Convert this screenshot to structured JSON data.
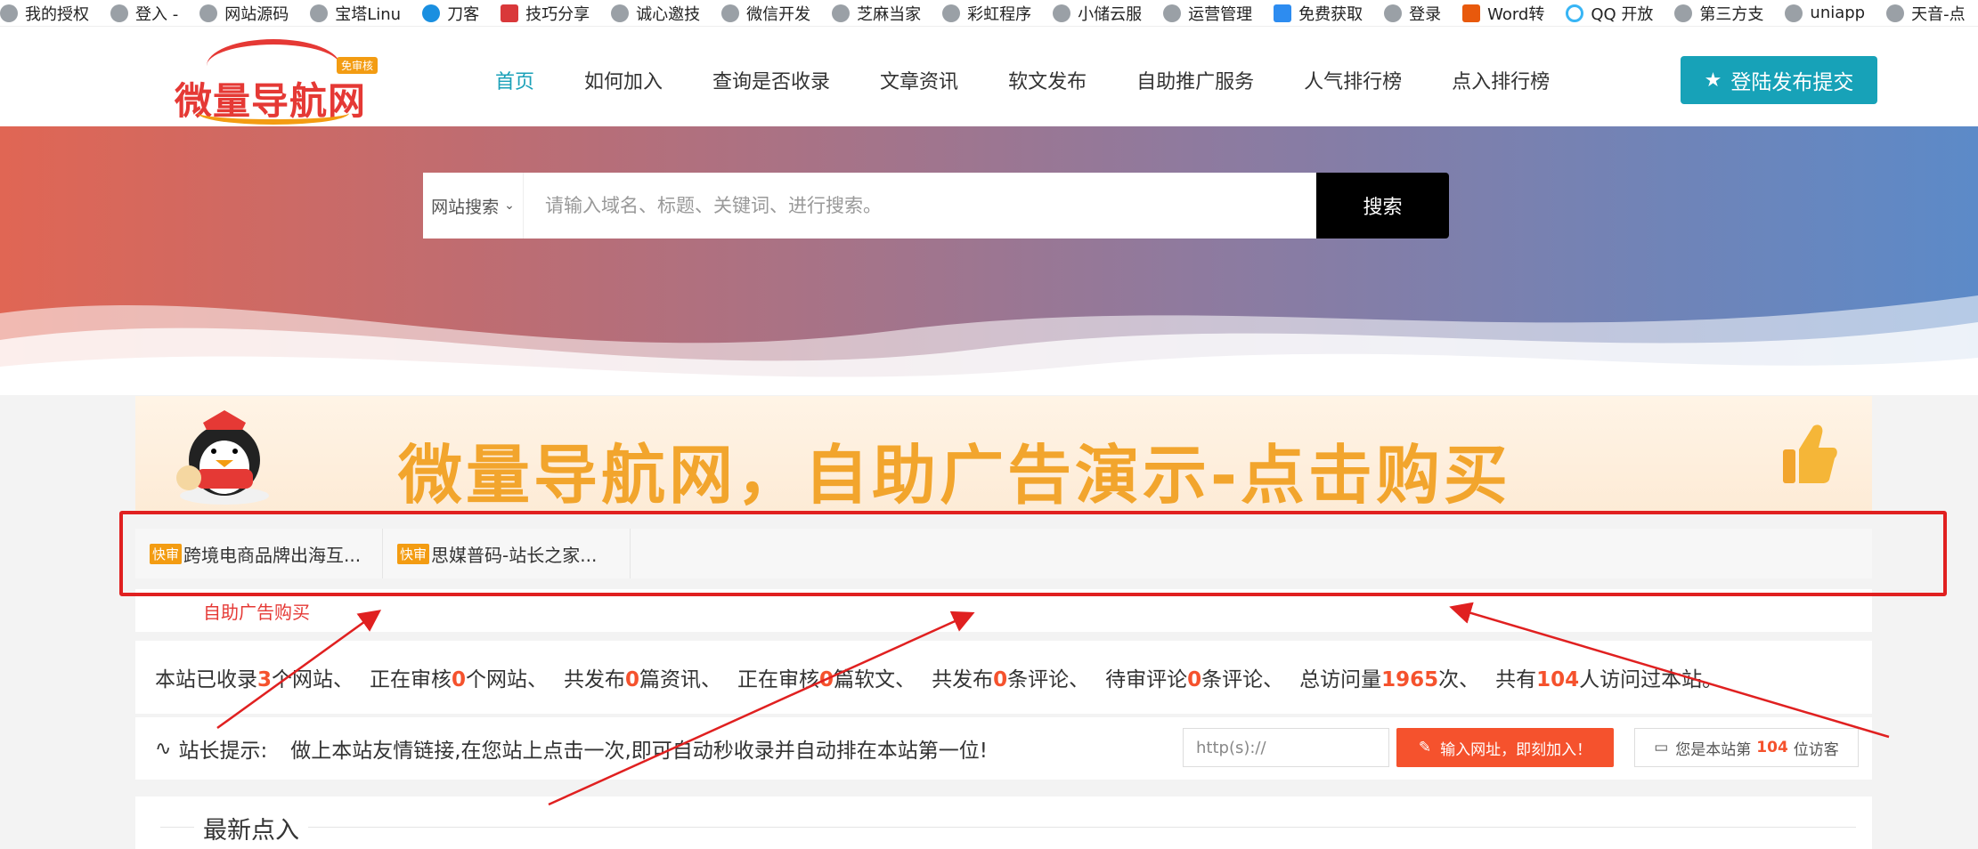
{
  "bookmarks": [
    {
      "label": "我的授权",
      "icon": "globe-icon"
    },
    {
      "label": "登入 -",
      "icon": "globe-icon"
    },
    {
      "label": "网站源码",
      "icon": "globe-icon"
    },
    {
      "label": "宝塔Linu",
      "icon": "globe-icon"
    },
    {
      "label": "刀客",
      "icon": "download-icon"
    },
    {
      "label": "技巧分享",
      "icon": "news-icon"
    },
    {
      "label": "诚心邀技",
      "icon": "globe-icon"
    },
    {
      "label": "微信开发",
      "icon": "globe-icon"
    },
    {
      "label": "芝麻当家",
      "icon": "globe-icon"
    },
    {
      "label": "彩虹程序",
      "icon": "globe-icon"
    },
    {
      "label": "小储云服",
      "icon": "globe-icon"
    },
    {
      "label": "运营管理",
      "icon": "globe-icon"
    },
    {
      "label": "免费获取",
      "icon": "pp-icon"
    },
    {
      "label": "登录",
      "icon": "globe-icon"
    },
    {
      "label": "Word转",
      "icon": "doc-icon"
    },
    {
      "label": "QQ 开放",
      "icon": "qq-icon"
    },
    {
      "label": "第三方支",
      "icon": "globe-icon"
    },
    {
      "label": "uniapp",
      "icon": "globe-icon"
    },
    {
      "label": "天音-点",
      "icon": "globe-icon"
    }
  ],
  "logo": {
    "text": "微量导航网",
    "badge": "免审核"
  },
  "nav": {
    "items": [
      "首页",
      "如何加入",
      "查询是否收录",
      "文章资讯",
      "软文发布",
      "自助推广服务",
      "人气排行榜",
      "点入排行榜"
    ],
    "active": "首页"
  },
  "login_button": "登陆发布提交",
  "search": {
    "select": "网站搜索",
    "placeholder": "请输入域名、标题、关键词、进行搜索。",
    "button": "搜索"
  },
  "ad_banner": {
    "text": "微量导航网，自助广告演示-点击购买"
  },
  "quick_links": [
    {
      "tag": "快审",
      "label": "跨境电商品牌出海互..."
    },
    {
      "tag": "快审",
      "label": "思媒普码-站长之家..."
    }
  ],
  "self_ad_link": "自助广告购买",
  "stats": {
    "s1_pre": "本站已收录",
    "s1_num": "3",
    "s1_post": "个网站、",
    "s2_pre": "正在审核",
    "s2_num": "0",
    "s2_post": "个网站、",
    "s3_pre": "共发布",
    "s3_num": "0",
    "s3_post": "篇资讯、",
    "s4_pre": "正在审核",
    "s4_num": "0",
    "s4_post": "篇软文、",
    "s5_pre": "共发布",
    "s5_num": "0",
    "s5_post": "条评论、",
    "s6_pre": "待审评论",
    "s6_num": "0",
    "s6_post": "条评论、",
    "s7_pre": "总访问量",
    "s7_num": "1965",
    "s7_post": "次、",
    "s8_pre": "共有",
    "s8_num": "104",
    "s8_post": "人访问过本站。"
  },
  "tips": {
    "label": "站长提示:",
    "text": "做上本站友情链接,在您站上点击一次,即可自动秒收录并自动排在本站第一位!",
    "url_placeholder": "http(s)://",
    "add_button": "输入网址，即刻加入！",
    "visitor_pre": "您是本站第",
    "visitor_num": "104",
    "visitor_post": "位访客"
  },
  "latest_title": "最新点入",
  "colors": {
    "accent": "#17a2b8",
    "highlight": "#f5522d",
    "annotation": "#e02020"
  }
}
